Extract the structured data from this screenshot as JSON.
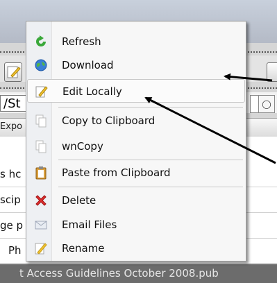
{
  "path_bar": {
    "value": "/St"
  },
  "column_header": {
    "text": "Expo"
  },
  "file_rows": [
    {
      "text": "s hc"
    },
    {
      "text": "scip"
    },
    {
      "text": "ge p"
    },
    {
      "text": "Ph"
    }
  ],
  "status_bar": {
    "text": "t Access Guidelines October 2008.pub"
  },
  "context_menu": {
    "items": [
      {
        "label": "Refresh",
        "icon": "refresh-icon"
      },
      {
        "label": "Download",
        "icon": "globe-download-icon"
      },
      {
        "label": "Edit Locally",
        "icon": "edit-pencil-icon"
      },
      {
        "label": "Copy to Clipboard",
        "icon": "copy-document-icon"
      },
      {
        "label": "wnCopy",
        "icon": "copy-document-icon"
      },
      {
        "label": "Paste from Clipboard",
        "icon": "clipboard-paste-icon"
      },
      {
        "label": "Delete",
        "icon": "red-x-delete-icon"
      },
      {
        "label": "Email Files",
        "icon": "envelope-icon"
      },
      {
        "label": "Rename",
        "icon": "rename-pencil-icon"
      }
    ]
  },
  "colors": {
    "menu_bg": "#f7f7f7",
    "status_bg": "#6c6c6c",
    "delete_red": "#e03030",
    "refresh_green": "#3aa83a"
  }
}
